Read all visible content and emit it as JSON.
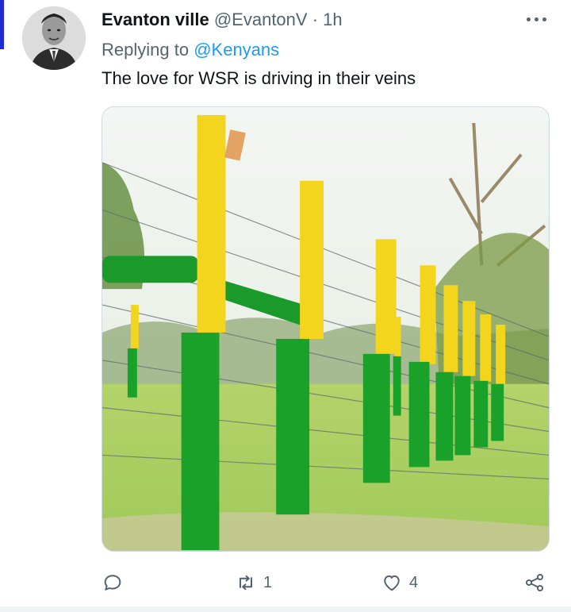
{
  "tweet": {
    "display_name": "Evanton ville",
    "handle": "@EvantonV",
    "separator": "·",
    "time": "1h",
    "replying_prefix": "Replying to",
    "replying_to": "@Kenyans",
    "text": "The love for WSR is driving in their veins"
  },
  "media": {
    "description_icon": "photo",
    "colors": {
      "post_yellow": "#f2d51c",
      "post_green": "#19a12a",
      "grass": "#a7cf4f",
      "sky": "#eef3ee"
    }
  },
  "actions": {
    "reply": {
      "icon": "comment-icon",
      "count": ""
    },
    "retweet": {
      "icon": "retweet-icon",
      "count": "1"
    },
    "like": {
      "icon": "heart-icon",
      "count": "4"
    },
    "share": {
      "icon": "share-icon"
    }
  },
  "icons": {
    "more": "more-dots-icon"
  }
}
